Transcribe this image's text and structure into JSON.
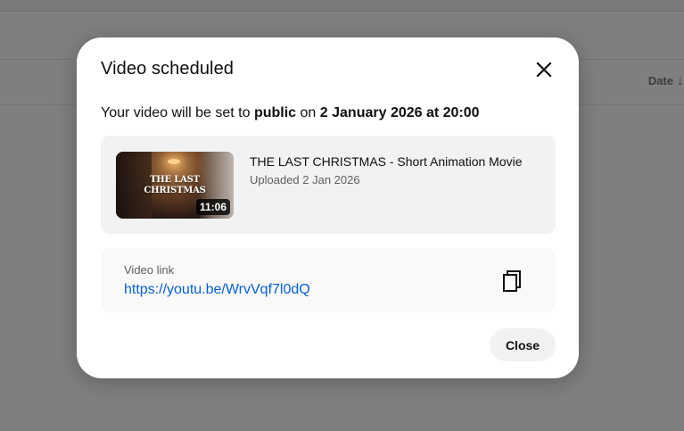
{
  "background": {
    "sort_label": "Date",
    "sort_icon": "arrow-down-icon"
  },
  "dialog": {
    "title": "Video scheduled",
    "close_icon": "close-icon",
    "message_prefix": "Your video will be set to",
    "visibility": "public",
    "message_mid": "on",
    "scheduled_datetime": "2 January 2026 at 20:00",
    "video": {
      "thumbnail_text_line1": "THE LAST",
      "thumbnail_text_line2": "CHRISTMAS",
      "duration": "11:06",
      "title": "THE LAST CHRISTMAS - Short Animation Movie",
      "uploaded": "Uploaded 2 Jan 2026"
    },
    "link": {
      "label": "Video link",
      "url": "https://youtu.be/WrvVqf7l0dQ",
      "copy_icon": "copy-icon"
    },
    "close_button_label": "Close"
  },
  "colors": {
    "link": "#065fd4",
    "card_bg": "#f2f2f2",
    "overlay": "#7f7f7f"
  }
}
